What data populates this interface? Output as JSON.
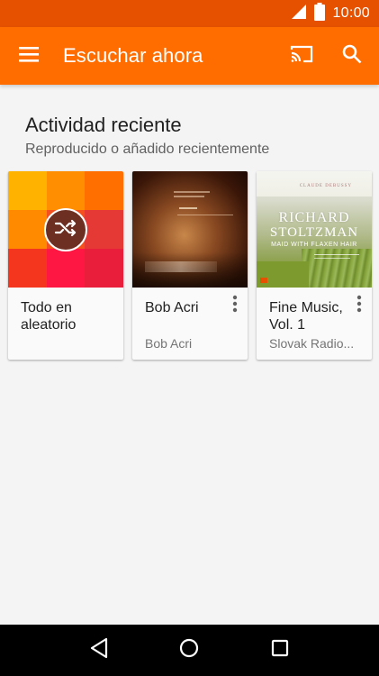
{
  "status_bar": {
    "time": "10:00"
  },
  "app_bar": {
    "title": "Escuchar ahora",
    "icons": {
      "menu": "menu-icon",
      "cast": "cast-icon",
      "search": "search-icon"
    },
    "color": "#ff6d00"
  },
  "section": {
    "title": "Actividad reciente",
    "subtitle": "Reproducido o añadido recientemente"
  },
  "cards": [
    {
      "title": "Todo en aleatorio",
      "subtitle": "",
      "art": "shuffle-mosaic",
      "icon": "shuffle-icon"
    },
    {
      "title": "Bob Acri",
      "subtitle": "Bob Acri",
      "art": "album-cover",
      "more": "more-vert-icon"
    },
    {
      "title": "Fine Music, Vol. 1",
      "subtitle": "Slovak Radio...",
      "art": "album-cover",
      "more": "more-vert-icon"
    }
  ],
  "album_art": {
    "fine_music": {
      "composer": "CLAUDE DEBUSSY",
      "artist_first": "RICHARD",
      "artist_last": "STOLTZMAN",
      "work": "MAID WITH FLAXEN HAIR"
    }
  },
  "nav": {
    "back": "back-icon",
    "home": "home-icon",
    "recents": "recents-icon"
  }
}
